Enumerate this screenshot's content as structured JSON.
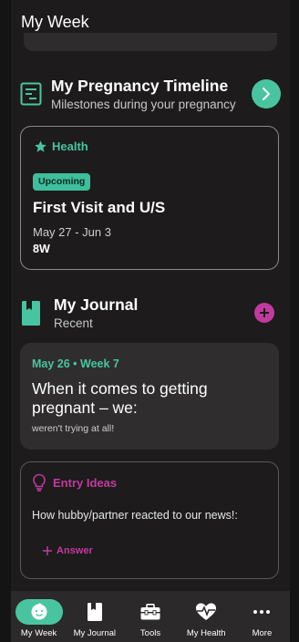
{
  "header": {
    "title": "My Week"
  },
  "timeline": {
    "title": "My Pregnancy Timeline",
    "subtitle": "Milestones during your pregnancy",
    "card": {
      "category": "Health",
      "badge": "Upcoming",
      "title": "First Visit and U/S",
      "dates": "May 27 - Jun 3",
      "week": "8W"
    }
  },
  "journal": {
    "title": "My Journal",
    "subtitle": "Recent",
    "entry": {
      "date": "May 26 • Week 7",
      "text": "When it comes to getting pregnant – we:",
      "answer": "weren't trying at all!"
    },
    "ideas": {
      "label": "Entry Ideas",
      "prompt": "How hubby/partner reacted to our news!:",
      "answer_label": "Answer"
    }
  },
  "nav": [
    {
      "label": "My Week",
      "icon": "baby-face-icon",
      "active": true
    },
    {
      "label": "My Journal",
      "icon": "journal-icon",
      "active": false
    },
    {
      "label": "Tools",
      "icon": "toolbox-icon",
      "active": false
    },
    {
      "label": "My Health",
      "icon": "heart-pulse-icon",
      "active": false
    },
    {
      "label": "More",
      "icon": "more-icon",
      "active": false
    }
  ],
  "colors": {
    "teal": "#49c4a1",
    "magenta": "#c13aa0",
    "background": "#1d1b1b",
    "card": "#2f2d2d"
  }
}
